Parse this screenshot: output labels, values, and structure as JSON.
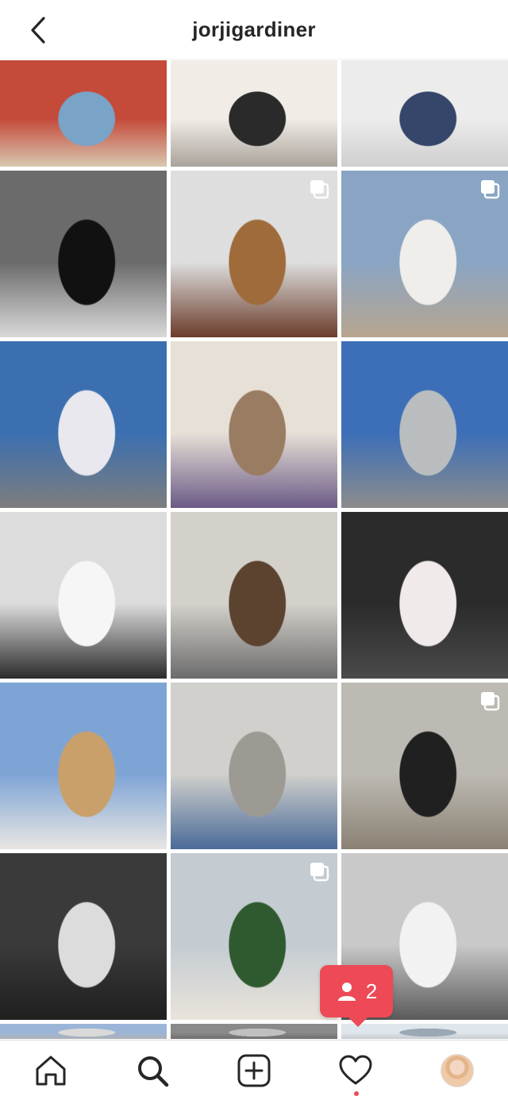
{
  "header": {
    "username": "jorjigardiner",
    "back_icon": "chevron-left-icon"
  },
  "notification": {
    "icon": "user-icon",
    "count": "2",
    "color": "#ed4956"
  },
  "nav": {
    "items": [
      "home-icon",
      "search-icon",
      "create-post-icon",
      "activity-heart-icon",
      "profile-avatar"
    ]
  },
  "posts": [
    {
      "multi": false,
      "colors": [
        "#c44a3a",
        "#7aa3c8",
        "#d8c7b0"
      ]
    },
    {
      "multi": false,
      "colors": [
        "#f1ece6",
        "#2a2a2a",
        "#a9a39b"
      ]
    },
    {
      "multi": false,
      "colors": [
        "#ececec",
        "#35466a",
        "#cfcfcf"
      ]
    },
    {
      "multi": false,
      "colors": [
        "#6b6b6b",
        "#111111",
        "#d9d9d9"
      ]
    },
    {
      "multi": true,
      "colors": [
        "#dedede",
        "#a06b3b",
        "#6b3c2a"
      ]
    },
    {
      "multi": true,
      "colors": [
        "#8aa5c4",
        "#f0eeea",
        "#b7a58f"
      ]
    },
    {
      "multi": false,
      "colors": [
        "#3b6fb0",
        "#e8e8ee",
        "#7d7d7d"
      ]
    },
    {
      "multi": false,
      "colors": [
        "#e7e0d7",
        "#9a7c62",
        "#6b5a86"
      ]
    },
    {
      "multi": false,
      "colors": [
        "#3c6fb8",
        "#b9bdbf",
        "#8c8c8c"
      ]
    },
    {
      "multi": false,
      "colors": [
        "#dcdcdc",
        "#f6f6f6",
        "#2b2b2b"
      ]
    },
    {
      "multi": false,
      "colors": [
        "#d4d1cb",
        "#5b4330",
        "#6b6b6b"
      ]
    },
    {
      "multi": false,
      "colors": [
        "#2b2b2b",
        "#f0eaea",
        "#4a4a4a"
      ]
    },
    {
      "multi": false,
      "colors": [
        "#7ea4d6",
        "#c9a06a",
        "#e8e6e2"
      ]
    },
    {
      "multi": false,
      "colors": [
        "#d1d0cc",
        "#9d9a94",
        "#4b6b99"
      ]
    },
    {
      "multi": true,
      "colors": [
        "#bdbab3",
        "#202020",
        "#8a8173"
      ]
    },
    {
      "multi": false,
      "colors": [
        "#3a3a3a",
        "#dcdcdc",
        "#1f1f1f"
      ]
    },
    {
      "multi": true,
      "colors": [
        "#c4ccd2",
        "#2f5a2f",
        "#e9e3da"
      ]
    },
    {
      "multi": false,
      "colors": [
        "#c9c9c9",
        "#f2f2f2",
        "#5a5a5a"
      ]
    },
    {
      "multi": false,
      "colors": [
        "#9bb5d8",
        "#d9d9d9",
        "#b0b0b0"
      ]
    },
    {
      "multi": false,
      "colors": [
        "#8a8a8a",
        "#c0c0c0",
        "#6a6a6a"
      ]
    },
    {
      "multi": false,
      "colors": [
        "#dfe6ec",
        "#9aa7b4",
        "#c3c8cd"
      ]
    }
  ]
}
